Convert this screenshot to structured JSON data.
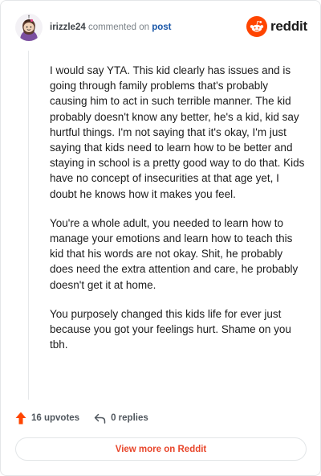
{
  "header": {
    "username": "irizzle24",
    "action_text": "commented on",
    "post_link": "post",
    "logo_text": "reddit",
    "avatar_icon": "snoo-avatar-icon",
    "logo_icon": "reddit-snoo-icon"
  },
  "comment": {
    "paragraphs": [
      "I would say YTA. This kid clearly has issues and is going through family problems that's probably causing him to act in such terrible manner. The kid probably doesn't know any better, he's a kid, kid say hurtful things. I'm not saying that it's okay, I'm just saying that kids need to learn how to be better and staying in school is a pretty good way to do that. Kids have no concept of insecurities at that age yet, I doubt he knows how it makes you feel.",
      "You're a whole adult, you needed to learn how to manage your emotions and learn how to teach this kid that his words are not okay. Shit, he probably does need the extra attention and care, he probably doesn't get it at home.",
      "You purposely changed this kids life for ever just because you got your feelings hurt. Shame on you tbh."
    ]
  },
  "actions": {
    "upvotes_label": "16 upvotes",
    "replies_label": "0 replies",
    "upvote_icon": "upvote-arrow-icon",
    "reply_icon": "reply-arrow-icon"
  },
  "footer": {
    "view_more_label": "View more on Reddit"
  },
  "colors": {
    "brand": "#ff4500",
    "link": "#1a57a8",
    "view_more_text": "#e8462b",
    "upvote": "#ff4500"
  }
}
